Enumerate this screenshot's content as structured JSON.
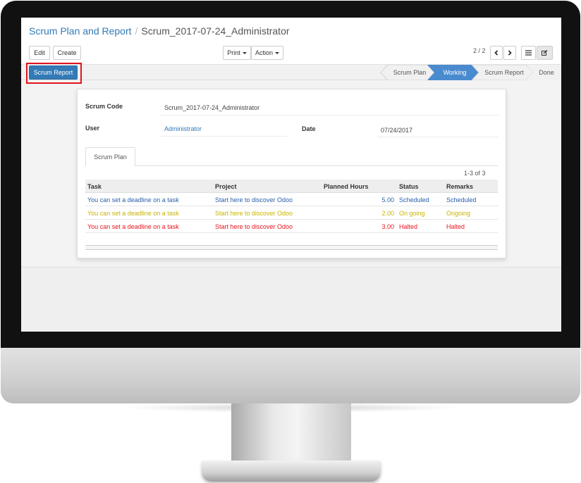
{
  "breadcrumb": {
    "parent": "Scrum Plan and Report",
    "separator": "/",
    "current": "Scrum_2017-07-24_Administrator"
  },
  "toolbar": {
    "edit_label": "Edit",
    "create_label": "Create",
    "print_label": "Print",
    "action_label": "Action",
    "pager": "2 / 2"
  },
  "header": {
    "scrum_report_button": "Scrum Report",
    "stages": [
      {
        "label": "Scrum Plan",
        "active": false
      },
      {
        "label": "Working",
        "active": true
      },
      {
        "label": "Scrum Report",
        "active": false
      },
      {
        "label": "Done",
        "active": false
      }
    ]
  },
  "form": {
    "scrum_code_label": "Scrum Code",
    "scrum_code_value": "Scrum_2017-07-24_Administrator",
    "user_label": "User",
    "user_value": "Administrator",
    "date_label": "Date",
    "date_value": "07/24/2017",
    "tab_label": "Scrum Plan",
    "record_count": "1-3 of 3",
    "columns": [
      "Task",
      "Project",
      "Planned Hours",
      "Status",
      "Remarks"
    ],
    "rows": [
      {
        "task": "You can set a deadline on a task",
        "project": "Start here to discover Odoo",
        "hours": "5.00",
        "status": "Scheduled",
        "remarks": "Scheduled",
        "color": "#2a5ea8"
      },
      {
        "task": "You can set a deadline on a task",
        "project": "Start here to discover Odoo",
        "hours": "2.00",
        "status": "On going",
        "remarks": "Ongoing",
        "color": "#c9b400"
      },
      {
        "task": "You can set a deadline on a task",
        "project": "Start here to discover Odoo",
        "hours": "3.00",
        "status": "Halted",
        "remarks": "Halted",
        "color": "#e8141e"
      }
    ]
  },
  "colors": {
    "primary": "#337ab7",
    "highlight": "#e0141e",
    "stage_active": "#4a8bd0"
  }
}
